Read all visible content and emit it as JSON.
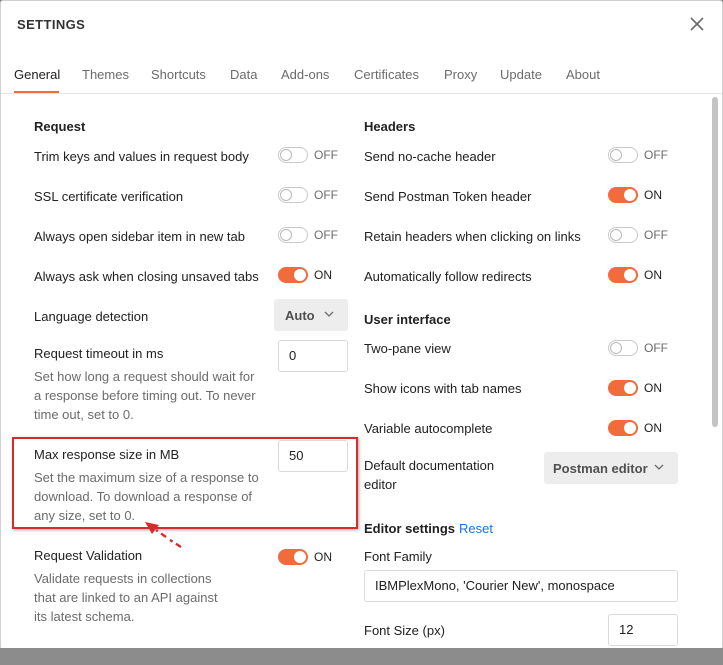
{
  "dialog": {
    "title": "SETTINGS"
  },
  "tabs": [
    "General",
    "Themes",
    "Shortcuts",
    "Data",
    "Add-ons",
    "Certificates",
    "Proxy",
    "Update",
    "About"
  ],
  "request": {
    "section_title": "Request",
    "trim_keys": {
      "label": "Trim keys and values in request body",
      "state": "OFF"
    },
    "ssl_verification": {
      "label": "SSL certificate verification",
      "state": "OFF"
    },
    "open_sidebar_new_tab": {
      "label": "Always open sidebar item in new tab",
      "state": "OFF"
    },
    "ask_closing_unsaved": {
      "label": "Always ask when closing unsaved tabs",
      "state": "ON"
    },
    "language_detection": {
      "label": "Language detection",
      "value": "Auto"
    },
    "request_timeout": {
      "label": "Request timeout in ms",
      "value": "0",
      "desc_lines": [
        "Set how long a request should wait for",
        "a response before timing out. To never",
        "time out, set to 0."
      ]
    },
    "max_response_size": {
      "label": "Max response size in MB",
      "value": "50",
      "desc_lines": [
        "Set the maximum size of a response to",
        "download. To download a response of",
        "any size, set to 0."
      ]
    },
    "request_validation": {
      "label": "Request Validation",
      "state": "ON",
      "desc_lines": [
        "Validate requests in collections",
        "that are linked to an API against",
        "its latest schema."
      ]
    }
  },
  "headers": {
    "section_title": "Headers",
    "no_cache": {
      "label": "Send no-cache header",
      "state": "OFF"
    },
    "postman_token": {
      "label": "Send Postman Token header",
      "state": "ON"
    },
    "retain_headers": {
      "label": "Retain headers when clicking on links",
      "state": "OFF"
    },
    "follow_redirects": {
      "label": "Automatically follow redirects",
      "state": "ON"
    }
  },
  "user_interface": {
    "section_title": "User interface",
    "two_pane": {
      "label": "Two-pane view",
      "state": "OFF"
    },
    "show_icons": {
      "label": "Show icons with tab names",
      "state": "ON"
    },
    "variable_autocomplete": {
      "label": "Variable autocomplete",
      "state": "ON"
    },
    "default_doc_editor": {
      "label_lines": [
        "Default documentation",
        "editor"
      ],
      "value": "Postman editor"
    }
  },
  "editor_settings": {
    "section_title": "Editor settings",
    "reset_label": "Reset",
    "font_family": {
      "label": "Font Family",
      "value": "IBMPlexMono, 'Courier New', monospace"
    },
    "font_size": {
      "label": "Font Size (px)",
      "value": "12"
    }
  },
  "colors": {
    "accent": "#f26b3a",
    "link": "#1a73e8",
    "annotation": "#d42c2c"
  }
}
